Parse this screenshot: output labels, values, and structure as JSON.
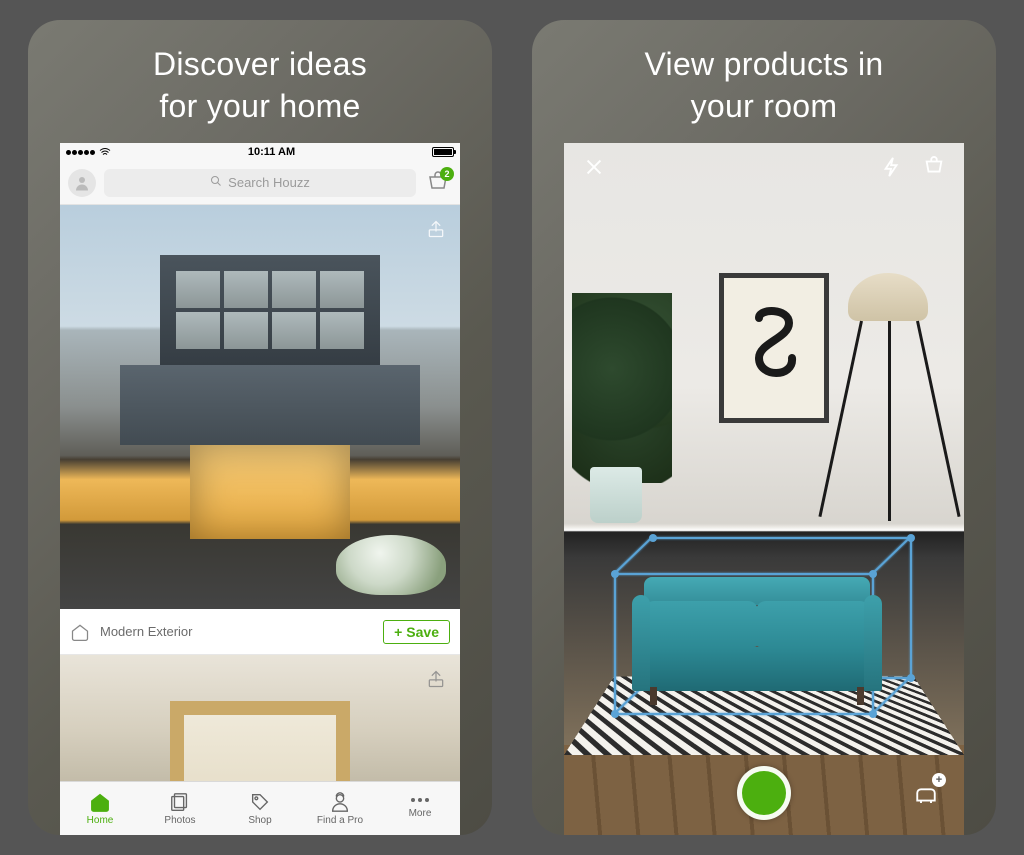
{
  "left": {
    "title_line1": "Discover ideas",
    "title_line2": "for your home",
    "status": {
      "time": "10:11 AM"
    },
    "search": {
      "placeholder": "Search Houzz"
    },
    "cart": {
      "badge": "2"
    },
    "card": {
      "category_label": "Modern Exterior",
      "save_label": "Save"
    },
    "tabs": {
      "home": "Home",
      "photos": "Photos",
      "shop": "Shop",
      "find_pro": "Find a Pro",
      "more": "More"
    }
  },
  "right": {
    "title_line1": "View products in",
    "title_line2": "your room"
  }
}
